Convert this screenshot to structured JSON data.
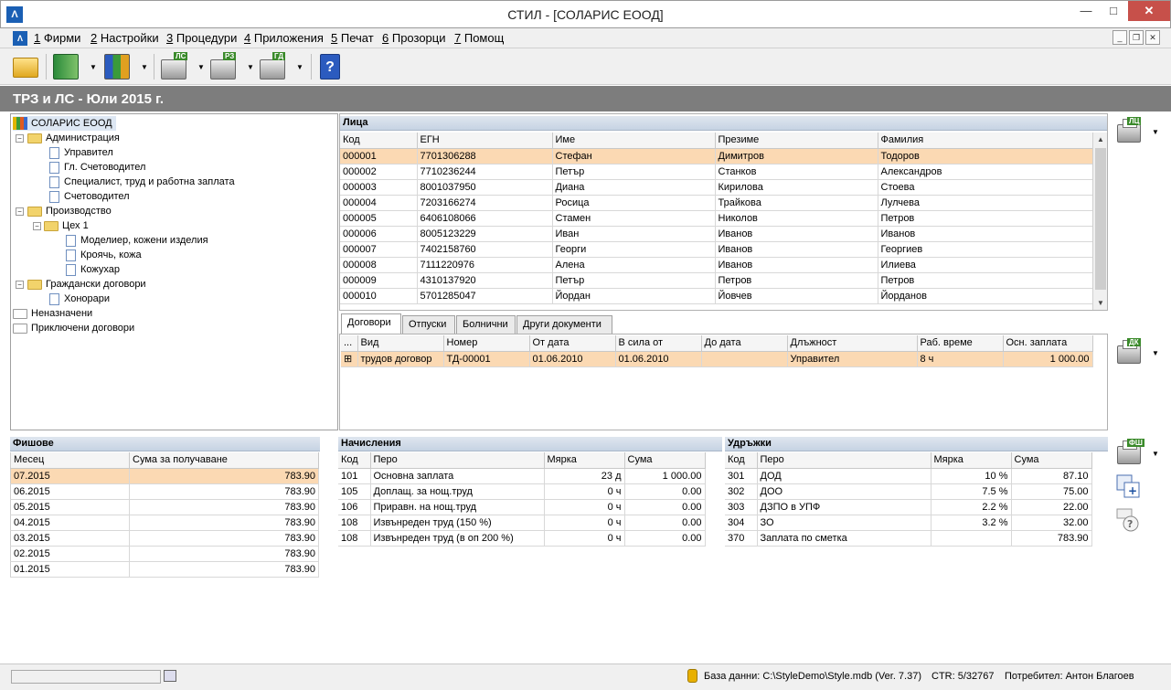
{
  "window": {
    "title": "СТИЛ - [СОЛАРИС ЕООД]",
    "app_icon": "style-logo-icon",
    "minimize": "—",
    "maximize": "□",
    "close": "✕"
  },
  "menu": {
    "items": [
      {
        "num": "1",
        "label": "Фирми"
      },
      {
        "num": "2",
        "label": "Настройки"
      },
      {
        "num": "3",
        "label": "Процедури"
      },
      {
        "num": "4",
        "label": "Приложения"
      },
      {
        "num": "5",
        "label": "Печат"
      },
      {
        "num": "6",
        "label": "Прозорци"
      },
      {
        "num": "7",
        "label": "Помощ"
      }
    ],
    "mdi": {
      "minimize": "_",
      "restore": "❐",
      "close": "✕"
    }
  },
  "toolbar": {
    "print_ls": "ЛС",
    "print_rz": "РЗ",
    "print_gd": "ГД",
    "dropdown": "▼",
    "help": "?"
  },
  "header": {
    "title": "ТРЗ и ЛС - Юли 2015 г."
  },
  "tree": {
    "root": "СОЛАРИС ЕООД",
    "nodes": [
      {
        "label": "Администрация"
      },
      {
        "label": "Управител"
      },
      {
        "label": "Гл. Счетоводител"
      },
      {
        "label": "Специалист, труд и работна заплата"
      },
      {
        "label": "Счетоводител"
      },
      {
        "label": "Производство"
      },
      {
        "label": "Цех 1"
      },
      {
        "label": "Моделиер, кожени изделия"
      },
      {
        "label": "Кроячь, кожа"
      },
      {
        "label": "Кожухар"
      },
      {
        "label": "Граждански договори"
      },
      {
        "label": "Хонорари"
      },
      {
        "label": "Неназначени"
      },
      {
        "label": "Приключени договори"
      }
    ],
    "minus": "−"
  },
  "persons": {
    "title": "Лица",
    "columns": [
      "Код",
      "ЕГН",
      "Име",
      "Презиме",
      "Фамилия"
    ],
    "rows": [
      [
        "000001",
        "7701306288",
        "Стефан",
        "Димитров",
        "Тодоров"
      ],
      [
        "000002",
        "7710236244",
        "Петър",
        "Станков",
        "Александров"
      ],
      [
        "000003",
        "8001037950",
        "Диана",
        "Кирилова",
        "Стоева"
      ],
      [
        "000004",
        "7203166274",
        "Росица",
        "Трайкова",
        "Лулчева"
      ],
      [
        "000005",
        "6406108066",
        "Стамен",
        "Николов",
        "Петров"
      ],
      [
        "000006",
        "8005123229",
        "Иван",
        "Иванов",
        "Иванов"
      ],
      [
        "000007",
        "7402158760",
        "Георги",
        "Иванов",
        "Георгиев"
      ],
      [
        "000008",
        "7111220976",
        "Алена",
        "Иванов",
        "Илиева"
      ],
      [
        "000009",
        "4310137920",
        "Петър",
        "Петров",
        "Петров"
      ],
      [
        "000010",
        "5701285047",
        "Йордан",
        "Йовчев",
        "Йорданов"
      ]
    ],
    "print_label": "ЛЦ"
  },
  "tabs": [
    "Договори",
    "Отпуски",
    "Болнични",
    "Други документи"
  ],
  "contracts": {
    "columns": [
      "...",
      "Вид",
      "Номер",
      "От дата",
      "В сила от",
      "До дата",
      "Длъжност",
      "Раб. време",
      "Осн. заплата"
    ],
    "rows": [
      [
        "⊞",
        "трудов договор",
        "ТД-00001",
        "01.06.2010",
        "01.06.2010",
        "",
        "Управител",
        "8 ч",
        "1 000.00"
      ]
    ],
    "print_label": "ДК"
  },
  "payslips": {
    "title": "Фишове",
    "columns": [
      "Месец",
      "Сума за получаване"
    ],
    "rows": [
      [
        "07.2015",
        "783.90"
      ],
      [
        "06.2015",
        "783.90"
      ],
      [
        "05.2015",
        "783.90"
      ],
      [
        "04.2015",
        "783.90"
      ],
      [
        "03.2015",
        "783.90"
      ],
      [
        "02.2015",
        "783.90"
      ],
      [
        "01.2015",
        "783.90"
      ]
    ]
  },
  "accruals": {
    "title": "Начисления",
    "columns": [
      "Код",
      "Перо",
      "Мярка",
      "Сума"
    ],
    "rows": [
      [
        "101",
        "Основна заплата",
        "23 д",
        "1 000.00"
      ],
      [
        "105",
        "Доплащ. за нощ.труд",
        "0 ч",
        "0.00"
      ],
      [
        "106",
        "Приравн. на нощ.труд",
        "0 ч",
        "0.00"
      ],
      [
        "108",
        "Извънреден труд (150 %)",
        "0 ч",
        "0.00"
      ],
      [
        "108",
        "Извънреден труд (в оп 200 %)",
        "0 ч",
        "0.00"
      ]
    ]
  },
  "deductions": {
    "title": "Удръжки",
    "columns": [
      "Код",
      "Перо",
      "Мярка",
      "Сума"
    ],
    "rows": [
      [
        "301",
        "ДОД",
        "10 %",
        "87.10"
      ],
      [
        "302",
        "ДОО",
        "7.5 %",
        "75.00"
      ],
      [
        "303",
        "ДЗПО в УПФ",
        "2.2 %",
        "22.00"
      ],
      [
        "304",
        "ЗО",
        "3.2 %",
        "32.00"
      ],
      [
        "370",
        "Заплата по сметка",
        "",
        "783.90"
      ]
    ],
    "print_label": "ФШ"
  },
  "status": {
    "database": "База данни: C:\\StyleDemo\\Style.mdb (Ver. 7.37)",
    "ctr": "CTR: 5/32767",
    "user": "Потребител: Антон Благоев"
  }
}
